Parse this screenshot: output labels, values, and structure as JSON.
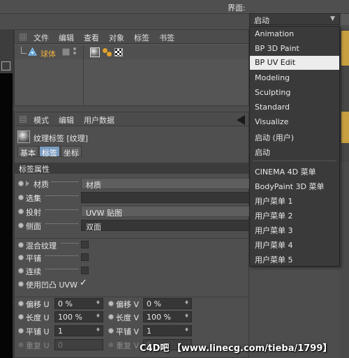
{
  "topbar": {
    "layout_label": "界面:",
    "layout_value": "启动"
  },
  "dropdown": {
    "items": [
      "Animation",
      "BP 3D Paint",
      "BP UV Edit",
      "Modeling",
      "Sculpting",
      "Standard",
      "Visualize",
      "启动 (用户)",
      "启动",
      "CINEMA 4D 菜单",
      "BodyPaint 3D 菜单",
      "用户菜单 1",
      "用户菜单 2",
      "用户菜单 3",
      "用户菜单 4",
      "用户菜单 5"
    ],
    "selected": "BP UV Edit"
  },
  "object_manager": {
    "menu": [
      "文件",
      "编辑",
      "查看",
      "对象",
      "标签",
      "书签"
    ],
    "object_name": "球体"
  },
  "attribute_manager": {
    "menu": [
      "模式",
      "编辑",
      "用户数据"
    ],
    "tag_title": "纹理标签 [纹理]",
    "tabs": [
      "基本",
      "标签",
      "坐标"
    ],
    "active_tab": "标签",
    "section": "标签属性",
    "props": {
      "material": {
        "label": "材质",
        "value": "材质"
      },
      "selection": {
        "label": "选集",
        "value": ""
      },
      "projection": {
        "label": "投射",
        "value": "UVW 贴图"
      },
      "side": {
        "label": "侧面",
        "value": "双面"
      },
      "mix": {
        "label": "混合纹理"
      },
      "tile": {
        "label": "平铺"
      },
      "seamless": {
        "label": "连续"
      },
      "use_bump_uvw": {
        "label": "使用凹凸 UVW",
        "check": "✓"
      }
    },
    "numbers": {
      "offset_u": {
        "label": "偏移 U",
        "value": "0 %"
      },
      "offset_v": {
        "label": "偏移 V",
        "value": "0 %"
      },
      "length_u": {
        "label": "长度 U",
        "value": "100 %"
      },
      "length_v": {
        "label": "长度 V",
        "value": "100 %"
      },
      "tiles_u": {
        "label": "平铺 U",
        "value": "1"
      },
      "tiles_v": {
        "label": "平铺 V",
        "value": "1"
      },
      "repeat_u": {
        "label": "重复 U",
        "value": "0"
      },
      "repeat_v": {
        "label": "重复 V",
        "value": "0"
      }
    }
  },
  "watermark": "C4D吧 【www.linecg.com/tieba/1799】"
}
